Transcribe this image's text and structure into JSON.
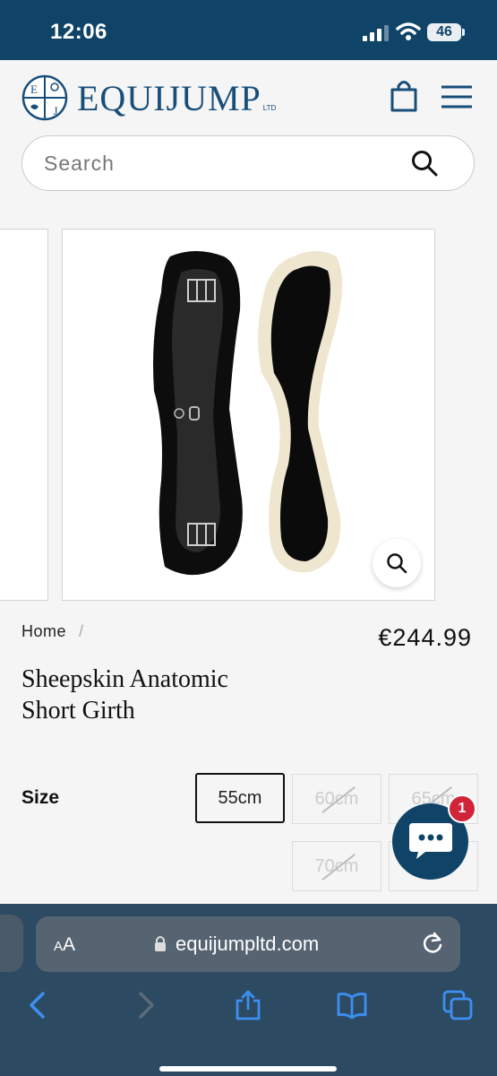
{
  "status_bar": {
    "time": "12:06",
    "battery": "46"
  },
  "header": {
    "logo_text": "EQUIJUMP",
    "logo_suffix": "LTD",
    "logo_letters": [
      "E",
      "J"
    ],
    "icons": [
      "cart-icon",
      "menu-icon"
    ]
  },
  "search": {
    "placeholder": "Search"
  },
  "breadcrumb": {
    "home": "Home",
    "separator": "/"
  },
  "product": {
    "price": "€244.99",
    "title_line1": "Sheepskin Anatomic",
    "title_line2": "Short Girth",
    "size_label": "Size",
    "sizes": [
      {
        "label": "55cm",
        "available": true,
        "selected": true
      },
      {
        "label": "60cm",
        "available": false,
        "selected": false
      },
      {
        "label": "65cm",
        "available": false,
        "selected": false
      },
      {
        "label": "70cm",
        "available": false,
        "selected": false
      },
      {
        "label": "",
        "available": false,
        "selected": false
      }
    ]
  },
  "chat": {
    "badge": "1"
  },
  "browser": {
    "aa_label_small": "A",
    "aa_label": "A",
    "url": "equijumpltd.com",
    "toolbar": [
      "back-icon",
      "forward-icon",
      "share-icon",
      "bookmarks-icon",
      "tabs-icon"
    ]
  },
  "colors": {
    "brand": "#174e7a",
    "status_bar": "#0f4468",
    "badge": "#d0243a",
    "browser_bg": "#2d4a63"
  }
}
